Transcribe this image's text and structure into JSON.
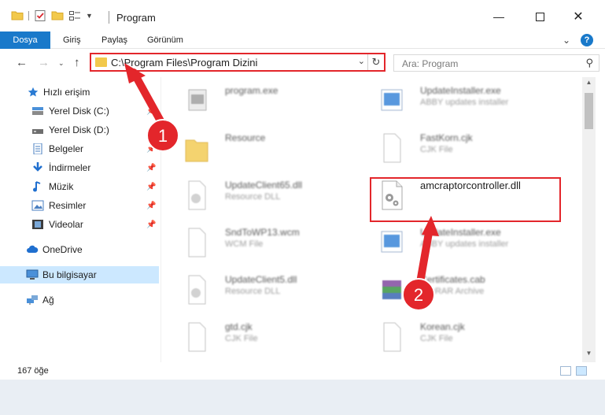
{
  "window": {
    "title": "Program",
    "controls": [
      "minimize-icon",
      "maximize-icon",
      "close-icon"
    ]
  },
  "ribbon": {
    "tabs": [
      {
        "label": "Dosya",
        "active": true
      },
      {
        "label": "Giriş"
      },
      {
        "label": "Paylaş"
      },
      {
        "label": "Görünüm"
      }
    ],
    "help_label": "?"
  },
  "address": {
    "path": "C:\\Program Files\\Program Dizini",
    "search_placeholder": "Ara: Program"
  },
  "sidebar": {
    "items": [
      {
        "label": "Hızlı erişim",
        "icon": "star-icon"
      },
      {
        "label": "Yerel Disk (C:)",
        "icon": "drive-icon",
        "pinned": true
      },
      {
        "label": "Yerel Disk (D:)",
        "icon": "drive-icon",
        "pinned": true
      },
      {
        "label": "Belgeler",
        "icon": "documents-icon",
        "pinned": true
      },
      {
        "label": "İndirmeler",
        "icon": "download-icon",
        "pinned": true
      },
      {
        "label": "Müzik",
        "icon": "music-icon",
        "pinned": true
      },
      {
        "label": "Resimler",
        "icon": "pictures-icon",
        "pinned": true
      },
      {
        "label": "Videolar",
        "icon": "videos-icon",
        "pinned": true
      },
      {
        "label": "OneDrive",
        "icon": "cloud-icon"
      },
      {
        "label": "Bu bilgisayar",
        "icon": "computer-icon",
        "selected": true
      },
      {
        "label": "Ağ",
        "icon": "network-icon"
      }
    ]
  },
  "files": [
    {
      "name": "program.exe",
      "type": "",
      "icon": "exe-icon"
    },
    {
      "name": "UpdateInstaller.exe",
      "type": "ABBY updates installer",
      "icon": "installer-icon"
    },
    {
      "name": "Resource",
      "type": "",
      "icon": "folder-icon"
    },
    {
      "name": "FastKorn.cjk",
      "type": "CJK File",
      "icon": "file-icon"
    },
    {
      "name": "UpdateClient65.dll",
      "type": "Resource DLL",
      "icon": "dll-icon"
    },
    {
      "name": "amcraptorcontroller.dll",
      "type": "",
      "icon": "dll-gear-icon",
      "highlighted": true
    },
    {
      "name": "SndToWP13.wcm",
      "type": "WCM File",
      "icon": "file-icon"
    },
    {
      "name": "UpdateInstaller.exe",
      "type": "ABBY updates installer",
      "icon": "installer-icon"
    },
    {
      "name": "UpdateClient5.dll",
      "type": "Resource DLL",
      "icon": "dll-icon"
    },
    {
      "name": "Certificates.cab",
      "type": "WinRAR Archive",
      "icon": "archive-icon"
    },
    {
      "name": "gtd.cjk",
      "type": "CJK File",
      "icon": "file-icon"
    },
    {
      "name": "Korean.cjk",
      "type": "CJK File",
      "icon": "file-icon"
    }
  ],
  "status": {
    "item_count": "167 öğe"
  },
  "annotations": {
    "step1": "1",
    "step2": "2"
  },
  "colors": {
    "accent": "#1979ca",
    "highlight_red": "#e3262b",
    "selected_bg": "#cce8ff"
  }
}
